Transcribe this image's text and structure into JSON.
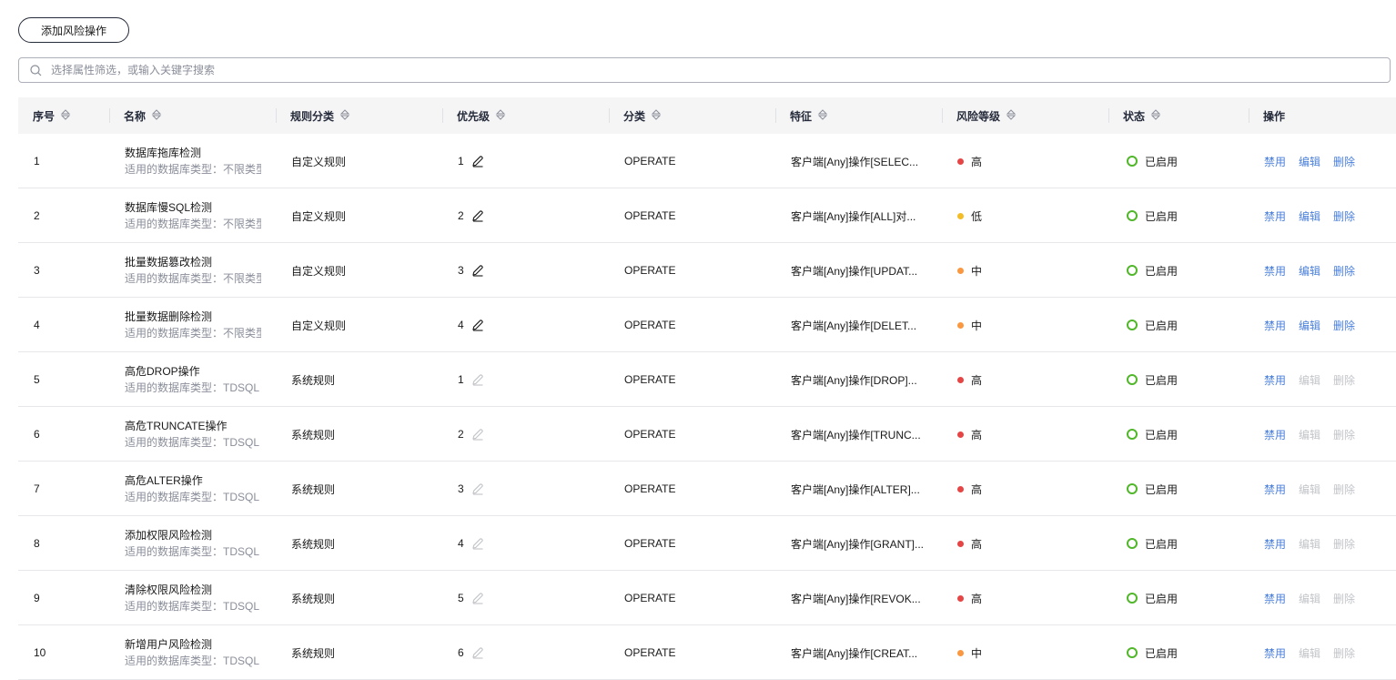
{
  "toolbar": {
    "add_label": "添加风险操作"
  },
  "search": {
    "placeholder": "选择属性筛选，或输入关键字搜索"
  },
  "columns": {
    "index": "序号",
    "name": "名称",
    "rule_type": "规则分类",
    "priority": "优先级",
    "category": "分类",
    "feature": "特征",
    "risk": "风险等级",
    "status": "状态",
    "ops": "操作"
  },
  "colors": {
    "high": "#e54545",
    "low": "#f2bd27",
    "mid": "#fa9841",
    "enabled": "#50b728",
    "link": "#4a7fd9",
    "disabled": "#c2c4c8"
  },
  "rows": [
    {
      "index": "1",
      "name": "数据库拖库检测",
      "sub": "适用的数据库类型：不限类型",
      "rule_type": "自定义规则",
      "priority": "1",
      "category": "OPERATE",
      "feature": "客户端[Any]操作[SELEC...",
      "risk": "高",
      "risk_level": "high",
      "status": "已启用",
      "disable": "禁用",
      "edit": "编辑",
      "delete": "删除",
      "editable": true
    },
    {
      "index": "2",
      "name": "数据库慢SQL检测",
      "sub": "适用的数据库类型：不限类型",
      "rule_type": "自定义规则",
      "priority": "2",
      "category": "OPERATE",
      "feature": "客户端[Any]操作[ALL]对...",
      "risk": "低",
      "risk_level": "low",
      "status": "已启用",
      "disable": "禁用",
      "edit": "编辑",
      "delete": "删除",
      "editable": true
    },
    {
      "index": "3",
      "name": "批量数据篡改检测",
      "sub": "适用的数据库类型：不限类型",
      "rule_type": "自定义规则",
      "priority": "3",
      "category": "OPERATE",
      "feature": "客户端[Any]操作[UPDAT...",
      "risk": "中",
      "risk_level": "mid",
      "status": "已启用",
      "disable": "禁用",
      "edit": "编辑",
      "delete": "删除",
      "editable": true
    },
    {
      "index": "4",
      "name": "批量数据删除检测",
      "sub": "适用的数据库类型：不限类型",
      "rule_type": "自定义规则",
      "priority": "4",
      "category": "OPERATE",
      "feature": "客户端[Any]操作[DELET...",
      "risk": "中",
      "risk_level": "mid",
      "status": "已启用",
      "disable": "禁用",
      "edit": "编辑",
      "delete": "删除",
      "editable": true
    },
    {
      "index": "5",
      "name": "高危DROP操作",
      "sub": "适用的数据库类型：TDSQL",
      "rule_type": "系统规则",
      "priority": "1",
      "category": "OPERATE",
      "feature": "客户端[Any]操作[DROP]...",
      "risk": "高",
      "risk_level": "high",
      "status": "已启用",
      "disable": "禁用",
      "edit": "编辑",
      "delete": "删除",
      "editable": false
    },
    {
      "index": "6",
      "name": "高危TRUNCATE操作",
      "sub": "适用的数据库类型：TDSQL",
      "rule_type": "系统规则",
      "priority": "2",
      "category": "OPERATE",
      "feature": "客户端[Any]操作[TRUNC...",
      "risk": "高",
      "risk_level": "high",
      "status": "已启用",
      "disable": "禁用",
      "edit": "编辑",
      "delete": "删除",
      "editable": false
    },
    {
      "index": "7",
      "name": "高危ALTER操作",
      "sub": "适用的数据库类型：TDSQL",
      "rule_type": "系统规则",
      "priority": "3",
      "category": "OPERATE",
      "feature": "客户端[Any]操作[ALTER]...",
      "risk": "高",
      "risk_level": "high",
      "status": "已启用",
      "disable": "禁用",
      "edit": "编辑",
      "delete": "删除",
      "editable": false
    },
    {
      "index": "8",
      "name": "添加权限风险检测",
      "sub": "适用的数据库类型：TDSQL",
      "rule_type": "系统规则",
      "priority": "4",
      "category": "OPERATE",
      "feature": "客户端[Any]操作[GRANT]...",
      "risk": "高",
      "risk_level": "high",
      "status": "已启用",
      "disable": "禁用",
      "edit": "编辑",
      "delete": "删除",
      "editable": false
    },
    {
      "index": "9",
      "name": "清除权限风险检测",
      "sub": "适用的数据库类型：TDSQL",
      "rule_type": "系统规则",
      "priority": "5",
      "category": "OPERATE",
      "feature": "客户端[Any]操作[REVOK...",
      "risk": "高",
      "risk_level": "high",
      "status": "已启用",
      "disable": "禁用",
      "edit": "编辑",
      "delete": "删除",
      "editable": false
    },
    {
      "index": "10",
      "name": "新增用户风险检测",
      "sub": "适用的数据库类型：TDSQL",
      "rule_type": "系统规则",
      "priority": "6",
      "category": "OPERATE",
      "feature": "客户端[Any]操作[CREAT...",
      "risk": "中",
      "risk_level": "mid",
      "status": "已启用",
      "disable": "禁用",
      "edit": "编辑",
      "delete": "删除",
      "editable": false
    }
  ]
}
